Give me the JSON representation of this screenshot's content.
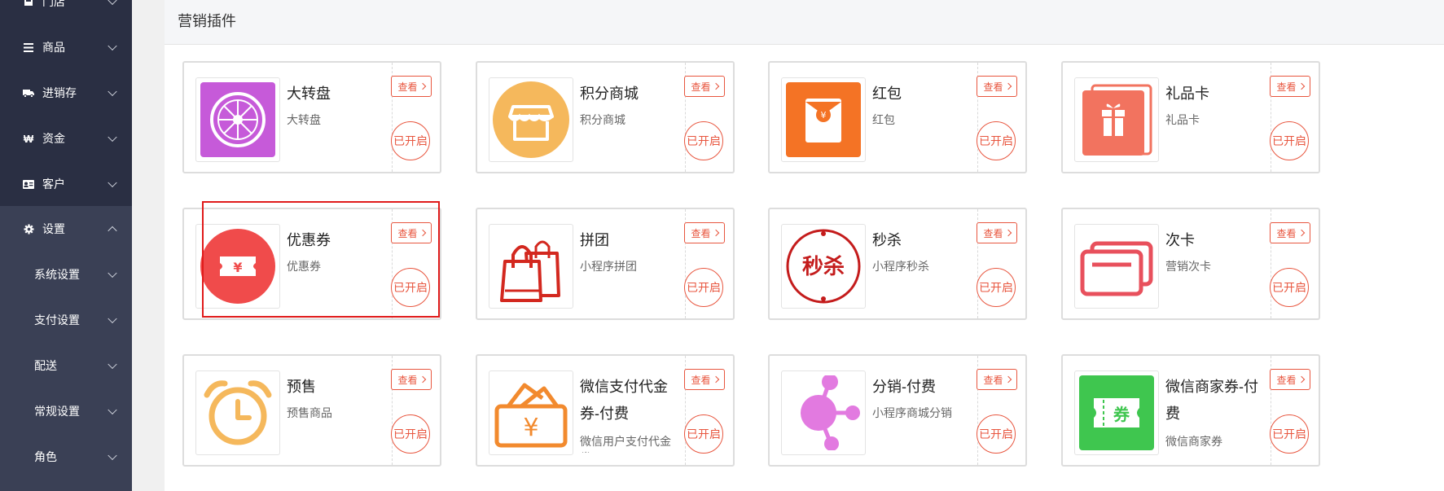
{
  "sidebar": {
    "items": [
      {
        "label": "门店",
        "icon": "store-icon"
      },
      {
        "label": "商品",
        "icon": "list-icon"
      },
      {
        "label": "进销存",
        "icon": "truck-icon"
      },
      {
        "label": "资金",
        "icon": "currency-icon"
      },
      {
        "label": "客户",
        "icon": "id-card-icon"
      },
      {
        "label": "设置",
        "icon": "gear-icon",
        "expanded": true
      }
    ],
    "sub_items": [
      {
        "label": "系统设置"
      },
      {
        "label": "支付设置"
      },
      {
        "label": "配送"
      },
      {
        "label": "常规设置"
      },
      {
        "label": "角色"
      }
    ]
  },
  "header": {
    "title": "营销插件"
  },
  "view_label": "查看",
  "status_label": "已开启",
  "colors": {
    "accent": "#e8563f",
    "sidebar": "#2a2f43",
    "highlight": "#e01b1b"
  },
  "plugins": [
    {
      "name": "大转盘",
      "desc": "大转盘",
      "icon": "roulette-wheel-icon"
    },
    {
      "name": "积分商城",
      "desc": "积分商城",
      "icon": "shop-icon"
    },
    {
      "name": "红包",
      "desc": "红包",
      "icon": "red-envelope-icon"
    },
    {
      "name": "礼品卡",
      "desc": "礼品卡",
      "icon": "gift-card-icon"
    },
    {
      "name": "优惠券",
      "desc": "优惠券",
      "icon": "coupon-icon",
      "highlighted": true
    },
    {
      "name": "拼团",
      "desc": "小程序拼团",
      "icon": "shopping-bag-icon"
    },
    {
      "name": "秒杀",
      "desc": "小程序秒杀",
      "icon": "flash-sale-icon",
      "icon_text": "秒杀"
    },
    {
      "name": "次卡",
      "desc": "营销次卡",
      "icon": "cards-icon"
    },
    {
      "name": "预售",
      "desc": "预售商品",
      "icon": "alarm-clock-icon"
    },
    {
      "name": "微信支付代金券-付费",
      "desc": "微信用户支付代金券",
      "icon": "wallet-icon"
    },
    {
      "name": "分销-付费",
      "desc": "小程序商城分销",
      "icon": "share-network-icon"
    },
    {
      "name": "微信商家券-付费",
      "desc": "微信商家券",
      "icon": "voucher-icon",
      "icon_text": "券"
    }
  ]
}
